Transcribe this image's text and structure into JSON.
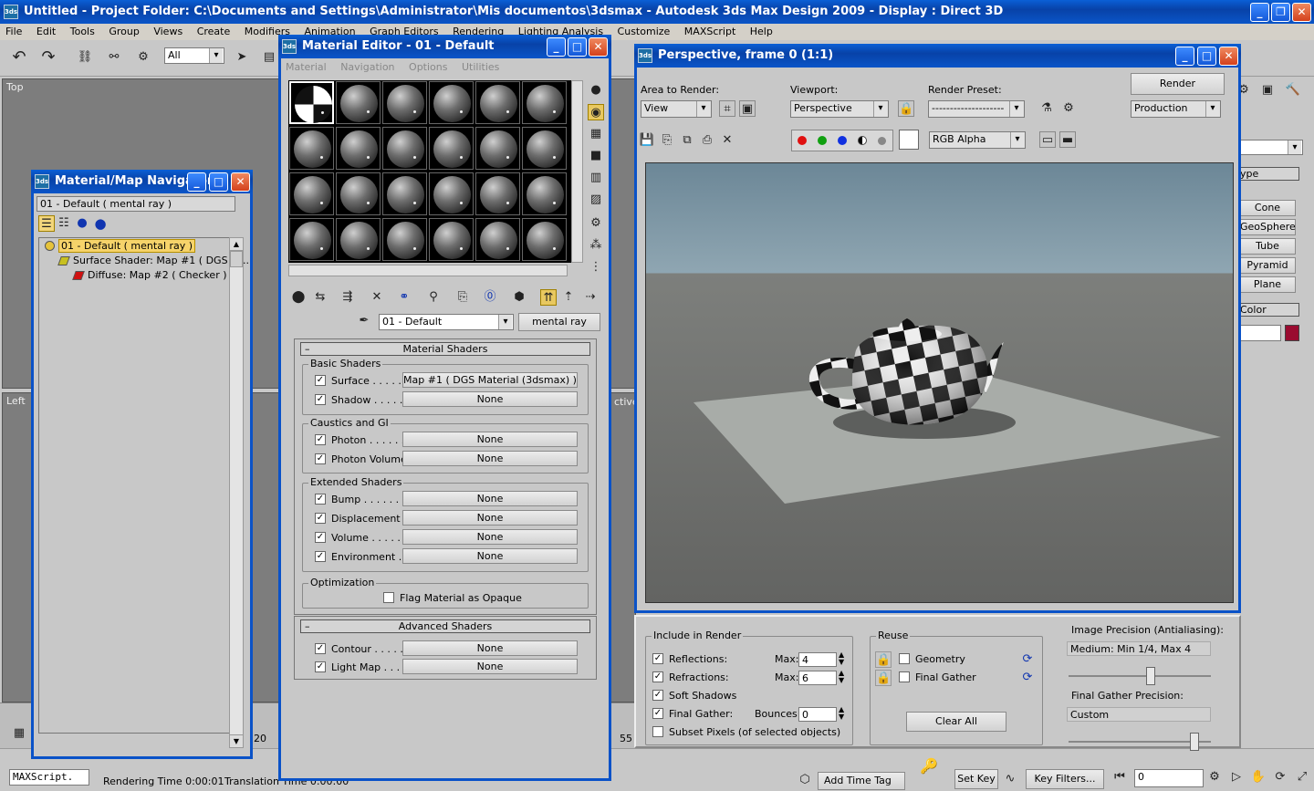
{
  "app": {
    "title": "Untitled     - Project Folder: C:\\Documents and Settings\\Administrator\\Mis documentos\\3dsmax     - Autodesk 3ds Max Design 2009     - Display : Direct 3D",
    "menu": [
      "File",
      "Edit",
      "Tools",
      "Group",
      "Views",
      "Create",
      "Modifiers",
      "Animation",
      "Graph Editors",
      "Rendering",
      "Lighting Analysis",
      "Customize",
      "MAXScript",
      "Help"
    ],
    "selection_filter": "All",
    "viewport_labels": {
      "top": "Top",
      "left": "Left",
      "active": "ctive"
    }
  },
  "navigator": {
    "title": "Material/Map Navigator",
    "field": "01 - Default  ( mental ray )",
    "tree": [
      "01 - Default  ( mental ray )",
      "Surface Shader: Map #1  ( DGS M...",
      "Diffuse: Map #2  ( Checker )"
    ]
  },
  "editor": {
    "title": "Material Editor - 01 - Default",
    "menu": [
      "Material",
      "Navigation",
      "Options",
      "Utilities"
    ],
    "name": "01 - Default",
    "type": "mental ray",
    "rollout_material": "Material Shaders",
    "rollout_advanced": "Advanced Shaders",
    "basic_title": "Basic Shaders",
    "caustics_title": "Caustics and GI",
    "extended_title": "Extended Shaders",
    "opt_title": "Optimization",
    "rows": [
      {
        "label": "Surface . . . . . .",
        "value": "Map #1  ( DGS Material (3dsmax) )"
      },
      {
        "label": "Shadow . . . . . .",
        "value": "None"
      },
      {
        "label": "Photon . . . . . . .",
        "value": "None"
      },
      {
        "label": "Photon Volume .",
        "value": "None"
      },
      {
        "label": "Bump . . . . . . . .",
        "value": "None"
      },
      {
        "label": "Displacement . .",
        "value": "None"
      },
      {
        "label": "Volume . . . . . . .",
        "value": "None"
      },
      {
        "label": "Environment . . .",
        "value": "None"
      },
      {
        "label": "Contour . . . . . .",
        "value": "None"
      },
      {
        "label": "Light Map . . . . .",
        "value": "None"
      }
    ],
    "opaque": "Flag Material as Opaque"
  },
  "render_win": {
    "title": "Perspective, frame 0 (1:1)",
    "area_label": "Area to Render:",
    "area_value": "View",
    "viewport_label": "Viewport:",
    "viewport_value": "Perspective",
    "preset_label": "Render Preset:",
    "preset_value": "--------------------",
    "render_btn": "Render",
    "production": "Production",
    "channel": "RGB Alpha"
  },
  "render_opts": {
    "include_title": "Include in Render",
    "reflections": "Reflections:",
    "refractions": "Refractions:",
    "soft_shadows": "Soft Shadows",
    "final_gather": "Final Gather:",
    "subset": "Subset Pixels (of selected objects)",
    "max_label": "Max:",
    "bounces_label": "Bounces:",
    "refl_max": "4",
    "refr_max": "6",
    "bounces": "0",
    "reuse_title": "Reuse",
    "geometry": "Geometry",
    "final_gather2": "Final Gather",
    "clear_all": "Clear All",
    "precision_label": "Image Precision (Antialiasing):",
    "precision_value": "Medium: Min 1/4, Max 4",
    "precision_level": 0.6,
    "fg_label": "Final Gather Precision:",
    "fg_value": "Custom",
    "fg_level": 0.92
  },
  "command_panel": {
    "tab_type": "ype",
    "buttons": [
      "Cone",
      "GeoSphere",
      "Tube",
      "Pyramid",
      "Plane"
    ],
    "color_title": "Color",
    "color": "#9a0b30"
  },
  "status": {
    "maxscript": "MAXScript.",
    "rendering_time": "Rendering Time  0:00:01",
    "translation_time": "Translation Time  0:00:00",
    "add_time_tag": "Add Time Tag",
    "set_key": "Set Key",
    "key_filters": "Key Filters...",
    "frame": "0",
    "timeline_20": "20",
    "timeline_55": "55"
  }
}
